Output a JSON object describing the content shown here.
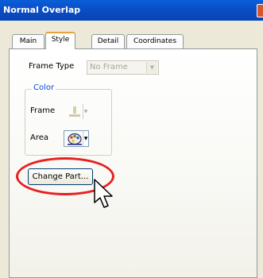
{
  "window": {
    "title": "Normal Overlap"
  },
  "tabs": [
    {
      "label": "Main",
      "active": false
    },
    {
      "label": "Style",
      "active": true
    },
    {
      "label": "Detail",
      "active": false
    },
    {
      "label": "Coordinates",
      "active": false
    }
  ],
  "frame_type": {
    "label": "Frame Type",
    "value": "No Frame",
    "enabled": false
  },
  "color_group": {
    "title": "Color",
    "frame": {
      "label": "Frame",
      "enabled": false,
      "icon": "paint-bucket-icon"
    },
    "area": {
      "label": "Area",
      "enabled": true,
      "icon": "palette-icon"
    }
  },
  "change_part_button": {
    "label": "Change Part..."
  },
  "colors": {
    "titlebar": "#0b4fc8",
    "highlight": "#e81f1f",
    "group_title": "#0046d5",
    "disabled_text": "#a6a49a"
  }
}
